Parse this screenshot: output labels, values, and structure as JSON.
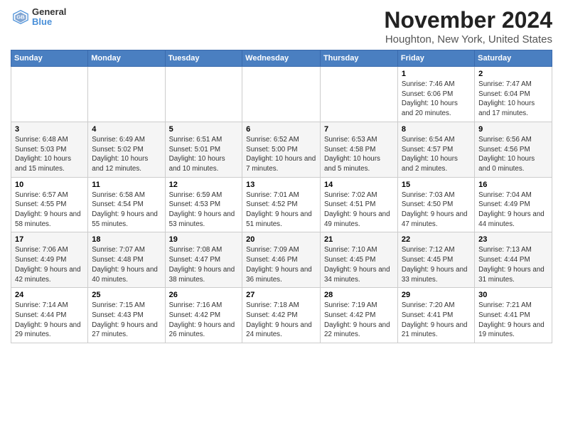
{
  "logo": {
    "general": "General",
    "blue": "Blue"
  },
  "header": {
    "month_year": "November 2024",
    "location": "Houghton, New York, United States"
  },
  "days_of_week": [
    "Sunday",
    "Monday",
    "Tuesday",
    "Wednesday",
    "Thursday",
    "Friday",
    "Saturday"
  ],
  "weeks": [
    [
      {
        "day": "",
        "info": ""
      },
      {
        "day": "",
        "info": ""
      },
      {
        "day": "",
        "info": ""
      },
      {
        "day": "",
        "info": ""
      },
      {
        "day": "",
        "info": ""
      },
      {
        "day": "1",
        "info": "Sunrise: 7:46 AM\nSunset: 6:06 PM\nDaylight: 10 hours and 20 minutes."
      },
      {
        "day": "2",
        "info": "Sunrise: 7:47 AM\nSunset: 6:04 PM\nDaylight: 10 hours and 17 minutes."
      }
    ],
    [
      {
        "day": "3",
        "info": "Sunrise: 6:48 AM\nSunset: 5:03 PM\nDaylight: 10 hours and 15 minutes."
      },
      {
        "day": "4",
        "info": "Sunrise: 6:49 AM\nSunset: 5:02 PM\nDaylight: 10 hours and 12 minutes."
      },
      {
        "day": "5",
        "info": "Sunrise: 6:51 AM\nSunset: 5:01 PM\nDaylight: 10 hours and 10 minutes."
      },
      {
        "day": "6",
        "info": "Sunrise: 6:52 AM\nSunset: 5:00 PM\nDaylight: 10 hours and 7 minutes."
      },
      {
        "day": "7",
        "info": "Sunrise: 6:53 AM\nSunset: 4:58 PM\nDaylight: 10 hours and 5 minutes."
      },
      {
        "day": "8",
        "info": "Sunrise: 6:54 AM\nSunset: 4:57 PM\nDaylight: 10 hours and 2 minutes."
      },
      {
        "day": "9",
        "info": "Sunrise: 6:56 AM\nSunset: 4:56 PM\nDaylight: 10 hours and 0 minutes."
      }
    ],
    [
      {
        "day": "10",
        "info": "Sunrise: 6:57 AM\nSunset: 4:55 PM\nDaylight: 9 hours and 58 minutes."
      },
      {
        "day": "11",
        "info": "Sunrise: 6:58 AM\nSunset: 4:54 PM\nDaylight: 9 hours and 55 minutes."
      },
      {
        "day": "12",
        "info": "Sunrise: 6:59 AM\nSunset: 4:53 PM\nDaylight: 9 hours and 53 minutes."
      },
      {
        "day": "13",
        "info": "Sunrise: 7:01 AM\nSunset: 4:52 PM\nDaylight: 9 hours and 51 minutes."
      },
      {
        "day": "14",
        "info": "Sunrise: 7:02 AM\nSunset: 4:51 PM\nDaylight: 9 hours and 49 minutes."
      },
      {
        "day": "15",
        "info": "Sunrise: 7:03 AM\nSunset: 4:50 PM\nDaylight: 9 hours and 47 minutes."
      },
      {
        "day": "16",
        "info": "Sunrise: 7:04 AM\nSunset: 4:49 PM\nDaylight: 9 hours and 44 minutes."
      }
    ],
    [
      {
        "day": "17",
        "info": "Sunrise: 7:06 AM\nSunset: 4:49 PM\nDaylight: 9 hours and 42 minutes."
      },
      {
        "day": "18",
        "info": "Sunrise: 7:07 AM\nSunset: 4:48 PM\nDaylight: 9 hours and 40 minutes."
      },
      {
        "day": "19",
        "info": "Sunrise: 7:08 AM\nSunset: 4:47 PM\nDaylight: 9 hours and 38 minutes."
      },
      {
        "day": "20",
        "info": "Sunrise: 7:09 AM\nSunset: 4:46 PM\nDaylight: 9 hours and 36 minutes."
      },
      {
        "day": "21",
        "info": "Sunrise: 7:10 AM\nSunset: 4:45 PM\nDaylight: 9 hours and 34 minutes."
      },
      {
        "day": "22",
        "info": "Sunrise: 7:12 AM\nSunset: 4:45 PM\nDaylight: 9 hours and 33 minutes."
      },
      {
        "day": "23",
        "info": "Sunrise: 7:13 AM\nSunset: 4:44 PM\nDaylight: 9 hours and 31 minutes."
      }
    ],
    [
      {
        "day": "24",
        "info": "Sunrise: 7:14 AM\nSunset: 4:44 PM\nDaylight: 9 hours and 29 minutes."
      },
      {
        "day": "25",
        "info": "Sunrise: 7:15 AM\nSunset: 4:43 PM\nDaylight: 9 hours and 27 minutes."
      },
      {
        "day": "26",
        "info": "Sunrise: 7:16 AM\nSunset: 4:42 PM\nDaylight: 9 hours and 26 minutes."
      },
      {
        "day": "27",
        "info": "Sunrise: 7:18 AM\nSunset: 4:42 PM\nDaylight: 9 hours and 24 minutes."
      },
      {
        "day": "28",
        "info": "Sunrise: 7:19 AM\nSunset: 4:42 PM\nDaylight: 9 hours and 22 minutes."
      },
      {
        "day": "29",
        "info": "Sunrise: 7:20 AM\nSunset: 4:41 PM\nDaylight: 9 hours and 21 minutes."
      },
      {
        "day": "30",
        "info": "Sunrise: 7:21 AM\nSunset: 4:41 PM\nDaylight: 9 hours and 19 minutes."
      }
    ]
  ]
}
